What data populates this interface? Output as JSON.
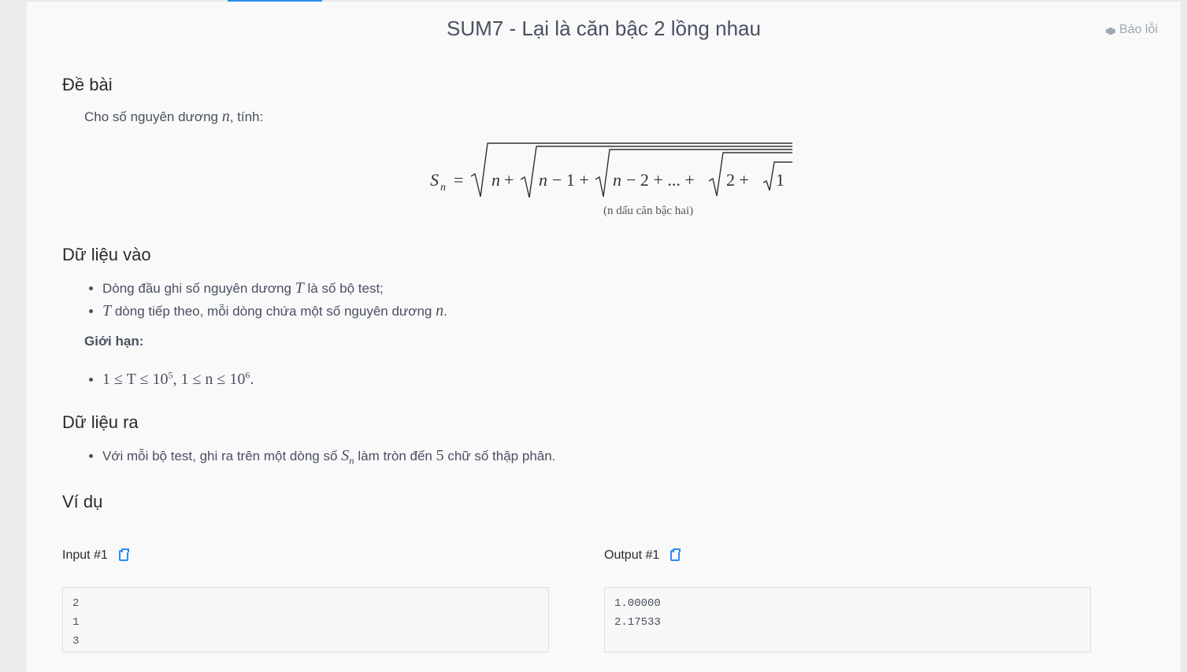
{
  "problem": {
    "title": "SUM7 - Lại là căn bậc 2 lồng nhau",
    "report_label": "Báo lỗi"
  },
  "statement": {
    "heading": "Đề bài",
    "intro_prefix": "Cho số nguyên dương ",
    "intro_var": "n",
    "intro_suffix": ", tính:",
    "formula_lhs": "S",
    "formula_lhs_sub": "n",
    "formula_note": "(n dấu căn bậc hai)"
  },
  "input": {
    "heading": "Dữ liệu vào",
    "items": [
      {
        "prefix": "Dòng đầu ghi số nguyên dương ",
        "var": "T",
        "suffix": " là số bộ test;"
      },
      {
        "var": "T",
        "middle": " dòng tiếp theo, mỗi dòng chứa một số nguyên dương ",
        "var2": "n",
        "suffix": "."
      }
    ],
    "limits_label": "Giới hạn:",
    "limits_text_a": "1 ≤ T ≤ 10",
    "limits_exp_a": "5",
    "limits_text_b": ", 1 ≤ n ≤ 10",
    "limits_exp_b": "6",
    "limits_end": "."
  },
  "output": {
    "heading": "Dữ liệu ra",
    "item_prefix": "Với mỗi bộ test, ghi ra trên một dòng số ",
    "item_var": "S",
    "item_var_sub": "n",
    "item_middle": " làm tròn đến ",
    "item_num": "5",
    "item_suffix": " chữ số thập phân."
  },
  "examples": {
    "heading": "Ví dụ",
    "input_label": "Input #1",
    "output_label": "Output #1",
    "input_text": "2\n1\n3",
    "output_text": "1.00000\n2.17533"
  },
  "colors": {
    "accent": "#2d8cf0",
    "title": "#495060",
    "muted": "#9ea7b4"
  },
  "icons": {
    "report": "bug-icon",
    "copy": "clipboard-icon"
  }
}
